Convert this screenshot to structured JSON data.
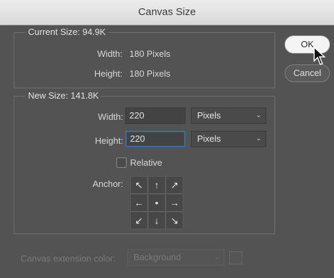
{
  "window": {
    "title": "Canvas Size"
  },
  "current_size": {
    "title": "Current Size: 94.9K",
    "width_label": "Width:",
    "width_value": "180 Pixels",
    "height_label": "Height:",
    "height_value": "180 Pixels"
  },
  "new_size": {
    "title": "New Size: 141.8K",
    "width_label": "Width:",
    "width_value": "220",
    "width_unit": "Pixels",
    "height_label": "Height:",
    "height_value": "220",
    "height_unit": "Pixels",
    "relative_label": "Relative",
    "relative_checked": false,
    "anchor_label": "Anchor:",
    "anchor_glyphs": [
      "↖",
      "↑",
      "↗",
      "←",
      "•",
      "→",
      "↙",
      "↓",
      "↘"
    ]
  },
  "extension": {
    "label": "Canvas extension color:",
    "value": "Background"
  },
  "buttons": {
    "ok": "OK",
    "cancel": "Cancel"
  },
  "colors": {
    "focus": "#3f6aa3",
    "dialog_bg": "#535353"
  }
}
